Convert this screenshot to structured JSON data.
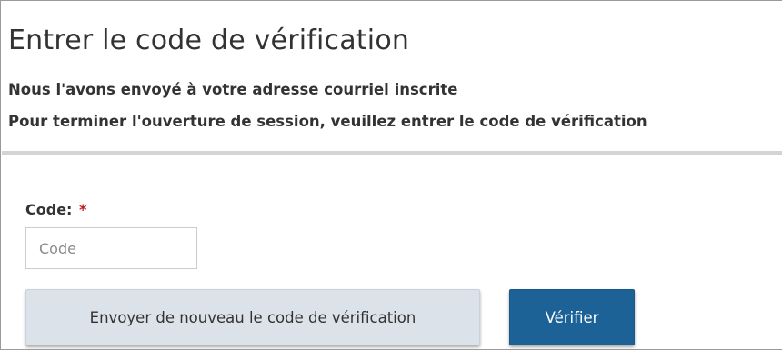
{
  "page": {
    "title": "Entrer le code de vérification",
    "message_line1": "Nous l'avons envoyé à votre adresse courriel inscrite",
    "message_line2": "Pour terminer l'ouverture de session, veuillez entrer le code de vérification"
  },
  "form": {
    "code_label": "Code:",
    "required_marker": "*",
    "code_placeholder": "Code",
    "code_value": ""
  },
  "actions": {
    "resend_label": "Envoyer de nouveau le code de vérification",
    "verify_label": "Vérifier"
  },
  "colors": {
    "verify_button": "#1d6297",
    "resend_button": "#dbe2ea",
    "required_marker": "#c91a1a"
  }
}
